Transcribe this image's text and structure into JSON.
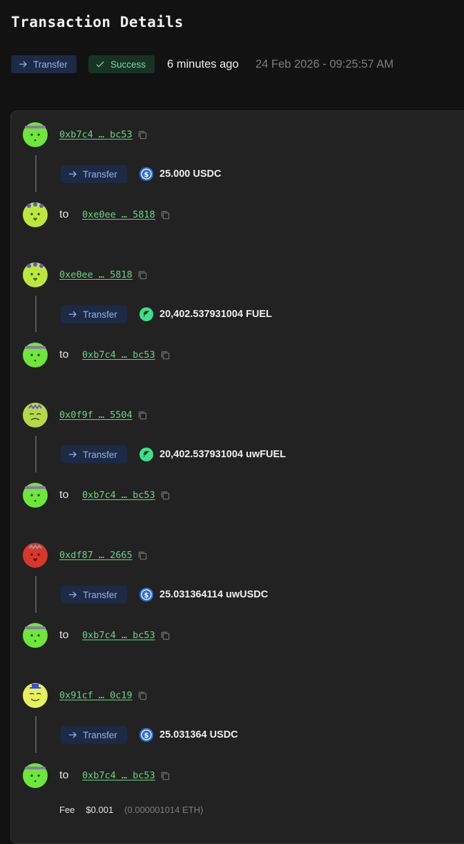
{
  "header": {
    "title": "Transaction Details",
    "type_label": "Transfer",
    "status_label": "Success",
    "time_ago": "6 minutes ago",
    "timestamp": "24 Feb 2026 - 09:25:57 AM"
  },
  "operations": [
    {
      "from": "0xb7c4 … bc53",
      "action": "Transfer",
      "amount": "25.000 USDC",
      "token_icon": "usdc-icon",
      "to_label": "to",
      "to": "0xe0ee … 5818"
    },
    {
      "from": "0xe0ee … 5818",
      "action": "Transfer",
      "amount": "20,402.537931004 FUEL",
      "token_icon": "fuel-icon",
      "to_label": "to",
      "to": "0xb7c4 … bc53"
    },
    {
      "from": "0x0f9f … 5504",
      "action": "Transfer",
      "amount": "20,402.537931004 uwFUEL",
      "token_icon": "fuel-icon",
      "to_label": "to",
      "to": "0xb7c4 … bc53"
    },
    {
      "from": "0xdf87 … 2665",
      "action": "Transfer",
      "amount": "25.031364114 uwUSDC",
      "token_icon": "usdc-icon",
      "to_label": "to",
      "to": "0xb7c4 … bc53"
    },
    {
      "from": "0x91cf … 0c19",
      "action": "Transfer",
      "amount": "25.031364 USDC",
      "token_icon": "usdc-icon",
      "to_label": "to",
      "to": "0xb7c4 … bc53"
    }
  ],
  "fee": {
    "label": "Fee",
    "value": "$0.001",
    "eth_value": "(0.000001014 ETH)"
  },
  "colors": {
    "address_green": "#67d97f",
    "transfer_pill_bg": "#1c2a46",
    "success_pill_bg": "#173325",
    "card_bg": "#222222"
  }
}
